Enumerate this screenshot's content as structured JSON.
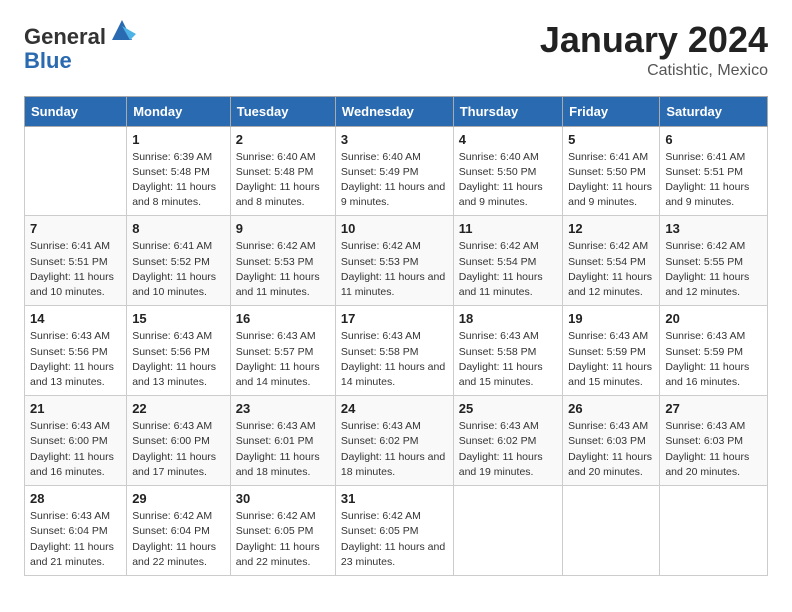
{
  "header": {
    "logo_general": "General",
    "logo_blue": "Blue",
    "month_title": "January 2024",
    "location": "Catishtic, Mexico"
  },
  "days_of_week": [
    "Sunday",
    "Monday",
    "Tuesday",
    "Wednesday",
    "Thursday",
    "Friday",
    "Saturday"
  ],
  "weeks": [
    [
      {
        "day": "",
        "sunrise": "",
        "sunset": "",
        "daylight": ""
      },
      {
        "day": "1",
        "sunrise": "Sunrise: 6:39 AM",
        "sunset": "Sunset: 5:48 PM",
        "daylight": "Daylight: 11 hours and 8 minutes."
      },
      {
        "day": "2",
        "sunrise": "Sunrise: 6:40 AM",
        "sunset": "Sunset: 5:48 PM",
        "daylight": "Daylight: 11 hours and 8 minutes."
      },
      {
        "day": "3",
        "sunrise": "Sunrise: 6:40 AM",
        "sunset": "Sunset: 5:49 PM",
        "daylight": "Daylight: 11 hours and 9 minutes."
      },
      {
        "day": "4",
        "sunrise": "Sunrise: 6:40 AM",
        "sunset": "Sunset: 5:50 PM",
        "daylight": "Daylight: 11 hours and 9 minutes."
      },
      {
        "day": "5",
        "sunrise": "Sunrise: 6:41 AM",
        "sunset": "Sunset: 5:50 PM",
        "daylight": "Daylight: 11 hours and 9 minutes."
      },
      {
        "day": "6",
        "sunrise": "Sunrise: 6:41 AM",
        "sunset": "Sunset: 5:51 PM",
        "daylight": "Daylight: 11 hours and 9 minutes."
      }
    ],
    [
      {
        "day": "7",
        "sunrise": "Sunrise: 6:41 AM",
        "sunset": "Sunset: 5:51 PM",
        "daylight": "Daylight: 11 hours and 10 minutes."
      },
      {
        "day": "8",
        "sunrise": "Sunrise: 6:41 AM",
        "sunset": "Sunset: 5:52 PM",
        "daylight": "Daylight: 11 hours and 10 minutes."
      },
      {
        "day": "9",
        "sunrise": "Sunrise: 6:42 AM",
        "sunset": "Sunset: 5:53 PM",
        "daylight": "Daylight: 11 hours and 11 minutes."
      },
      {
        "day": "10",
        "sunrise": "Sunrise: 6:42 AM",
        "sunset": "Sunset: 5:53 PM",
        "daylight": "Daylight: 11 hours and 11 minutes."
      },
      {
        "day": "11",
        "sunrise": "Sunrise: 6:42 AM",
        "sunset": "Sunset: 5:54 PM",
        "daylight": "Daylight: 11 hours and 11 minutes."
      },
      {
        "day": "12",
        "sunrise": "Sunrise: 6:42 AM",
        "sunset": "Sunset: 5:54 PM",
        "daylight": "Daylight: 11 hours and 12 minutes."
      },
      {
        "day": "13",
        "sunrise": "Sunrise: 6:42 AM",
        "sunset": "Sunset: 5:55 PM",
        "daylight": "Daylight: 11 hours and 12 minutes."
      }
    ],
    [
      {
        "day": "14",
        "sunrise": "Sunrise: 6:43 AM",
        "sunset": "Sunset: 5:56 PM",
        "daylight": "Daylight: 11 hours and 13 minutes."
      },
      {
        "day": "15",
        "sunrise": "Sunrise: 6:43 AM",
        "sunset": "Sunset: 5:56 PM",
        "daylight": "Daylight: 11 hours and 13 minutes."
      },
      {
        "day": "16",
        "sunrise": "Sunrise: 6:43 AM",
        "sunset": "Sunset: 5:57 PM",
        "daylight": "Daylight: 11 hours and 14 minutes."
      },
      {
        "day": "17",
        "sunrise": "Sunrise: 6:43 AM",
        "sunset": "Sunset: 5:58 PM",
        "daylight": "Daylight: 11 hours and 14 minutes."
      },
      {
        "day": "18",
        "sunrise": "Sunrise: 6:43 AM",
        "sunset": "Sunset: 5:58 PM",
        "daylight": "Daylight: 11 hours and 15 minutes."
      },
      {
        "day": "19",
        "sunrise": "Sunrise: 6:43 AM",
        "sunset": "Sunset: 5:59 PM",
        "daylight": "Daylight: 11 hours and 15 minutes."
      },
      {
        "day": "20",
        "sunrise": "Sunrise: 6:43 AM",
        "sunset": "Sunset: 5:59 PM",
        "daylight": "Daylight: 11 hours and 16 minutes."
      }
    ],
    [
      {
        "day": "21",
        "sunrise": "Sunrise: 6:43 AM",
        "sunset": "Sunset: 6:00 PM",
        "daylight": "Daylight: 11 hours and 16 minutes."
      },
      {
        "day": "22",
        "sunrise": "Sunrise: 6:43 AM",
        "sunset": "Sunset: 6:00 PM",
        "daylight": "Daylight: 11 hours and 17 minutes."
      },
      {
        "day": "23",
        "sunrise": "Sunrise: 6:43 AM",
        "sunset": "Sunset: 6:01 PM",
        "daylight": "Daylight: 11 hours and 18 minutes."
      },
      {
        "day": "24",
        "sunrise": "Sunrise: 6:43 AM",
        "sunset": "Sunset: 6:02 PM",
        "daylight": "Daylight: 11 hours and 18 minutes."
      },
      {
        "day": "25",
        "sunrise": "Sunrise: 6:43 AM",
        "sunset": "Sunset: 6:02 PM",
        "daylight": "Daylight: 11 hours and 19 minutes."
      },
      {
        "day": "26",
        "sunrise": "Sunrise: 6:43 AM",
        "sunset": "Sunset: 6:03 PM",
        "daylight": "Daylight: 11 hours and 20 minutes."
      },
      {
        "day": "27",
        "sunrise": "Sunrise: 6:43 AM",
        "sunset": "Sunset: 6:03 PM",
        "daylight": "Daylight: 11 hours and 20 minutes."
      }
    ],
    [
      {
        "day": "28",
        "sunrise": "Sunrise: 6:43 AM",
        "sunset": "Sunset: 6:04 PM",
        "daylight": "Daylight: 11 hours and 21 minutes."
      },
      {
        "day": "29",
        "sunrise": "Sunrise: 6:42 AM",
        "sunset": "Sunset: 6:04 PM",
        "daylight": "Daylight: 11 hours and 22 minutes."
      },
      {
        "day": "30",
        "sunrise": "Sunrise: 6:42 AM",
        "sunset": "Sunset: 6:05 PM",
        "daylight": "Daylight: 11 hours and 22 minutes."
      },
      {
        "day": "31",
        "sunrise": "Sunrise: 6:42 AM",
        "sunset": "Sunset: 6:05 PM",
        "daylight": "Daylight: 11 hours and 23 minutes."
      },
      {
        "day": "",
        "sunrise": "",
        "sunset": "",
        "daylight": ""
      },
      {
        "day": "",
        "sunrise": "",
        "sunset": "",
        "daylight": ""
      },
      {
        "day": "",
        "sunrise": "",
        "sunset": "",
        "daylight": ""
      }
    ]
  ]
}
